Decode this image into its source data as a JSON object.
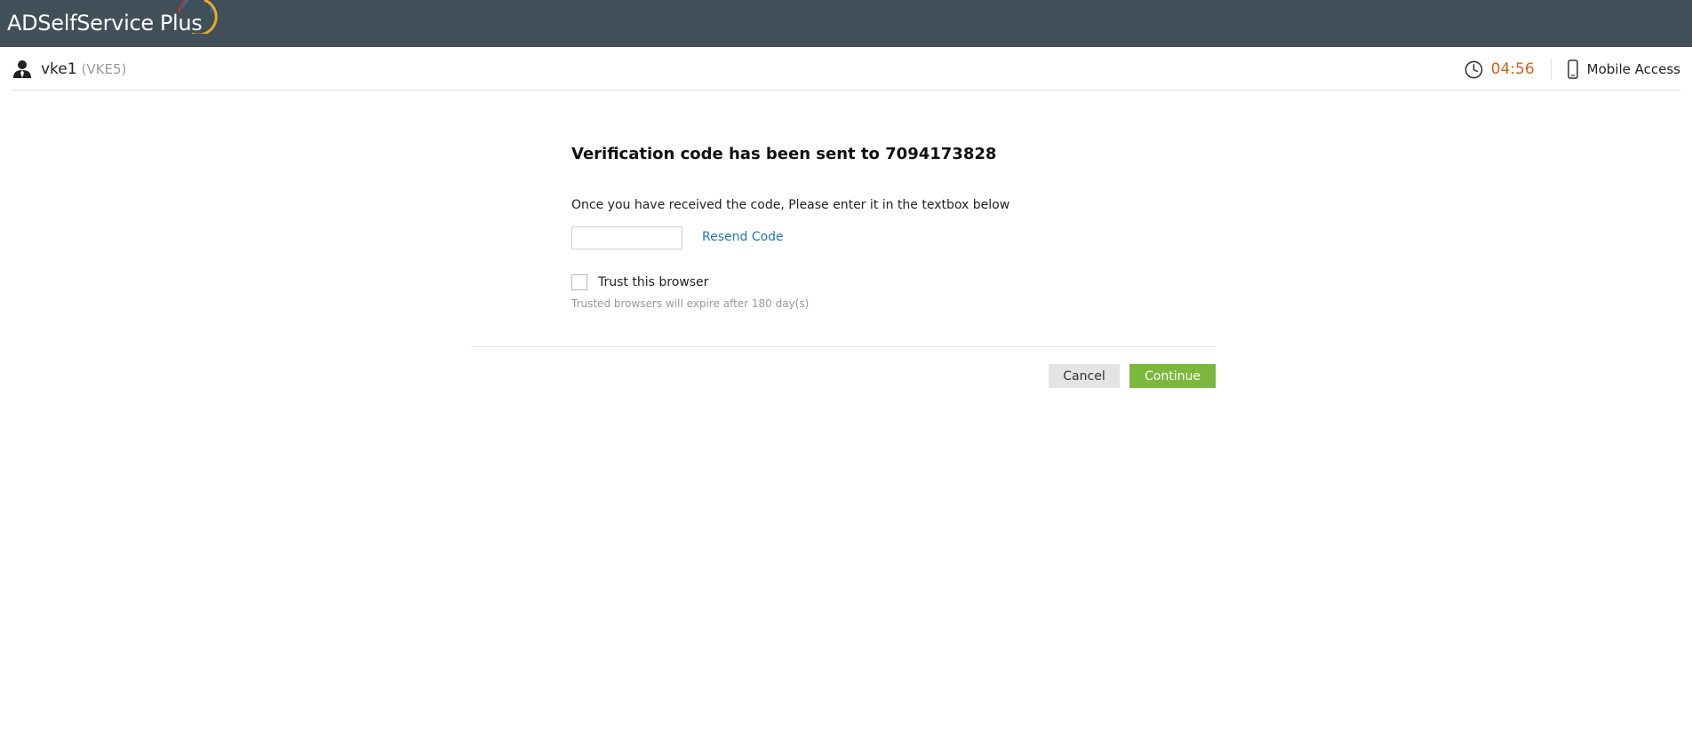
{
  "header": {
    "brand_main": "ADSelfService",
    "brand_plus": "Plus",
    "logo_arc_colors": [
      "#c0392b",
      "#2a6fb5",
      "#e8a92b"
    ]
  },
  "userbar": {
    "user_name": "vke1",
    "user_id": "(VKE5)",
    "timer": "04:56",
    "mobile_access_label": "Mobile Access",
    "timer_color": "#d0641b"
  },
  "verification": {
    "heading": "Verification code has been sent to 7094173828",
    "instruction": "Once you have received the code, Please enter it in the textbox below",
    "code_value": "",
    "resend_label": "Resend Code",
    "trust_label": "Trust this browser",
    "trust_checked": false,
    "trust_note": "Trusted browsers will expire after 180 day(s)"
  },
  "actions": {
    "cancel_label": "Cancel",
    "continue_label": "Continue",
    "continue_color": "#7cb83d"
  }
}
